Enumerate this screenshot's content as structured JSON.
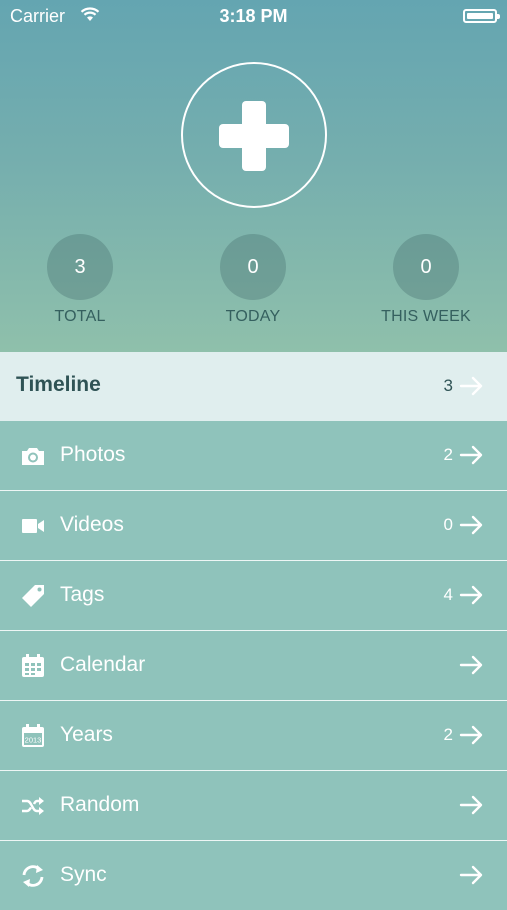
{
  "status": {
    "carrier": "Carrier",
    "time": "3:18 PM"
  },
  "stats": [
    {
      "value": "3",
      "label": "TOTAL"
    },
    {
      "value": "0",
      "label": "TODAY"
    },
    {
      "value": "0",
      "label": "THIS WEEK"
    }
  ],
  "menu": [
    {
      "label": "Timeline",
      "count": "3",
      "icon": "timeline"
    },
    {
      "label": "Photos",
      "count": "2",
      "icon": "camera-icon"
    },
    {
      "label": "Videos",
      "count": "0",
      "icon": "video-camera-icon"
    },
    {
      "label": "Tags",
      "count": "4",
      "icon": "tag-icon"
    },
    {
      "label": "Calendar",
      "count": "",
      "icon": "calendar-icon"
    },
    {
      "label": "Years",
      "count": "2",
      "icon": "year-calendar-icon",
      "year": "2013"
    },
    {
      "label": "Random",
      "count": "",
      "icon": "shuffle-icon"
    },
    {
      "label": "Sync",
      "count": "",
      "icon": "sync-icon"
    }
  ],
  "colors": {
    "accent": "#8fc3bb",
    "header_top": "#64a5b1",
    "active_row": "#e0eeee"
  }
}
